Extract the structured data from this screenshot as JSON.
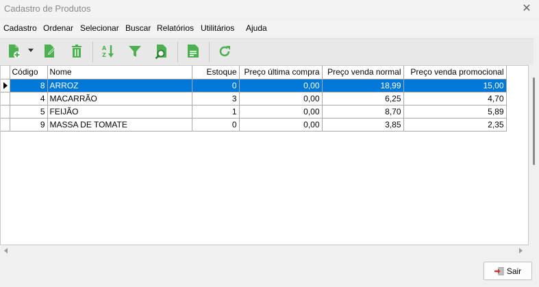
{
  "window": {
    "title": "Cadastro de Produtos"
  },
  "menu": [
    "Cadastro",
    "Ordenar",
    "Selecionar",
    "Buscar",
    "Relatórios",
    "Utilitários",
    "Ajuda"
  ],
  "toolbar": {
    "accent": "#4caf50",
    "icons": [
      "new-file-icon",
      "dropdown-icon",
      "edit-icon",
      "delete-icon",
      "sort-az-icon",
      "filter-icon",
      "search-file-icon",
      "report-icon",
      "refresh-icon"
    ]
  },
  "grid": {
    "columns": [
      "Código",
      "Nome",
      "Estoque",
      "Preço última compra",
      "Preço venda normal",
      "Preço venda promocional"
    ],
    "rows": [
      [
        "8",
        "ARROZ",
        "0",
        "0,00",
        "18,99",
        "15,00"
      ],
      [
        "4",
        "MACARRÃO",
        "3",
        "0,00",
        "6,25",
        "4,70"
      ],
      [
        "5",
        "FEIJÃO",
        "1",
        "0,00",
        "8,70",
        "5,89"
      ],
      [
        "9",
        "MASSA DE TOMATE",
        "0",
        "0,00",
        "3,85",
        "2,35"
      ]
    ],
    "selected_row_index": 0,
    "selection_color": "#0078d7"
  },
  "footer": {
    "exit_label": "Sair"
  }
}
